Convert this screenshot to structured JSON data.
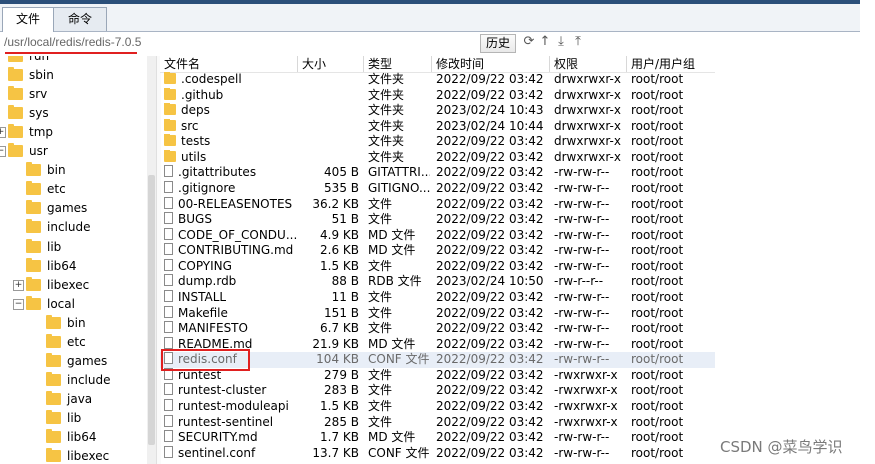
{
  "tabs": [
    {
      "label": "文件",
      "active": true
    },
    {
      "label": "命令",
      "active": false
    }
  ],
  "path": "/usr/local/redis/redis-7.0.5",
  "toolbar": {
    "history_label": "历史",
    "icons": [
      "refresh-icon",
      "up-directory-icon",
      "download-icon",
      "upload-icon"
    ]
  },
  "tree": [
    {
      "label": "run",
      "depth": 0
    },
    {
      "label": "sbin",
      "depth": 0
    },
    {
      "label": "srv",
      "depth": 0
    },
    {
      "label": "sys",
      "depth": 0
    },
    {
      "label": "tmp",
      "depth": 0,
      "expandable": true
    },
    {
      "label": "usr",
      "depth": 0,
      "expanded": true
    },
    {
      "label": "bin",
      "depth": 1
    },
    {
      "label": "etc",
      "depth": 1
    },
    {
      "label": "games",
      "depth": 1
    },
    {
      "label": "include",
      "depth": 1
    },
    {
      "label": "lib",
      "depth": 1
    },
    {
      "label": "lib64",
      "depth": 1
    },
    {
      "label": "libexec",
      "depth": 1,
      "expandable": true
    },
    {
      "label": "local",
      "depth": 1,
      "expanded": true
    },
    {
      "label": "bin",
      "depth": 2
    },
    {
      "label": "etc",
      "depth": 2
    },
    {
      "label": "games",
      "depth": 2
    },
    {
      "label": "include",
      "depth": 2
    },
    {
      "label": "java",
      "depth": 2
    },
    {
      "label": "lib",
      "depth": 2
    },
    {
      "label": "lib64",
      "depth": 2
    },
    {
      "label": "libexec",
      "depth": 2
    }
  ],
  "columns": [
    "文件名",
    "大小",
    "类型",
    "修改时间",
    "权限",
    "用户/用户组"
  ],
  "files": [
    {
      "name": ".codespell",
      "size": "",
      "type": "文件夹",
      "date": "2022/09/22 03:42",
      "perm": "drwxrwxr-x",
      "owner": "root/root",
      "folder": true
    },
    {
      "name": ".github",
      "size": "",
      "type": "文件夹",
      "date": "2022/09/22 03:42",
      "perm": "drwxrwxr-x",
      "owner": "root/root",
      "folder": true
    },
    {
      "name": "deps",
      "size": "",
      "type": "文件夹",
      "date": "2023/02/24 10:43",
      "perm": "drwxrwxr-x",
      "owner": "root/root",
      "folder": true
    },
    {
      "name": "src",
      "size": "",
      "type": "文件夹",
      "date": "2023/02/24 10:44",
      "perm": "drwxrwxr-x",
      "owner": "root/root",
      "folder": true
    },
    {
      "name": "tests",
      "size": "",
      "type": "文件夹",
      "date": "2022/09/22 03:42",
      "perm": "drwxrwxr-x",
      "owner": "root/root",
      "folder": true
    },
    {
      "name": "utils",
      "size": "",
      "type": "文件夹",
      "date": "2022/09/22 03:42",
      "perm": "drwxrwxr-x",
      "owner": "root/root",
      "folder": true
    },
    {
      "name": ".gitattributes",
      "size": "405 B",
      "type": "GITATTRI...",
      "date": "2022/09/22 03:42",
      "perm": "-rw-rw-r--",
      "owner": "root/root"
    },
    {
      "name": ".gitignore",
      "size": "535 B",
      "type": "GITIGNO...",
      "date": "2022/09/22 03:42",
      "perm": "-rw-rw-r--",
      "owner": "root/root"
    },
    {
      "name": "00-RELEASENOTES",
      "size": "36.2 KB",
      "type": "文件",
      "date": "2022/09/22 03:42",
      "perm": "-rw-rw-r--",
      "owner": "root/root"
    },
    {
      "name": "BUGS",
      "size": "51 B",
      "type": "文件",
      "date": "2022/09/22 03:42",
      "perm": "-rw-rw-r--",
      "owner": "root/root"
    },
    {
      "name": "CODE_OF_CONDU...",
      "size": "4.9 KB",
      "type": "MD 文件",
      "date": "2022/09/22 03:42",
      "perm": "-rw-rw-r--",
      "owner": "root/root"
    },
    {
      "name": "CONTRIBUTING.md",
      "size": "2.6 KB",
      "type": "MD 文件",
      "date": "2022/09/22 03:42",
      "perm": "-rw-rw-r--",
      "owner": "root/root"
    },
    {
      "name": "COPYING",
      "size": "1.5 KB",
      "type": "文件",
      "date": "2022/09/22 03:42",
      "perm": "-rw-rw-r--",
      "owner": "root/root"
    },
    {
      "name": "dump.rdb",
      "size": "88 B",
      "type": "RDB 文件",
      "date": "2023/02/24 10:50",
      "perm": "-rw-r--r--",
      "owner": "root/root"
    },
    {
      "name": "INSTALL",
      "size": "11 B",
      "type": "文件",
      "date": "2022/09/22 03:42",
      "perm": "-rw-rw-r--",
      "owner": "root/root"
    },
    {
      "name": "Makefile",
      "size": "151 B",
      "type": "文件",
      "date": "2022/09/22 03:42",
      "perm": "-rw-rw-r--",
      "owner": "root/root"
    },
    {
      "name": "MANIFESTO",
      "size": "6.7 KB",
      "type": "文件",
      "date": "2022/09/22 03:42",
      "perm": "-rw-rw-r--",
      "owner": "root/root"
    },
    {
      "name": "README.md",
      "size": "21.9 KB",
      "type": "MD 文件",
      "date": "2022/09/22 03:42",
      "perm": "-rw-rw-r--",
      "owner": "root/root"
    },
    {
      "name": "redis.conf",
      "size": "104 KB",
      "type": "CONF 文件",
      "date": "2022/09/22 03:42",
      "perm": "-rw-rw-r--",
      "owner": "root/root",
      "selected": true
    },
    {
      "name": "runtest",
      "size": "279 B",
      "type": "文件",
      "date": "2022/09/22 03:42",
      "perm": "-rwxrwxr-x",
      "owner": "root/root"
    },
    {
      "name": "runtest-cluster",
      "size": "283 B",
      "type": "文件",
      "date": "2022/09/22 03:42",
      "perm": "-rwxrwxr-x",
      "owner": "root/root"
    },
    {
      "name": "runtest-moduleapi",
      "size": "1.5 KB",
      "type": "文件",
      "date": "2022/09/22 03:42",
      "perm": "-rwxrwxr-x",
      "owner": "root/root"
    },
    {
      "name": "runtest-sentinel",
      "size": "285 B",
      "type": "文件",
      "date": "2022/09/22 03:42",
      "perm": "-rwxrwxr-x",
      "owner": "root/root"
    },
    {
      "name": "SECURITY.md",
      "size": "1.7 KB",
      "type": "MD 文件",
      "date": "2022/09/22 03:42",
      "perm": "-rw-rw-r--",
      "owner": "root/root"
    },
    {
      "name": "sentinel.conf",
      "size": "13.7 KB",
      "type": "CONF 文件",
      "date": "2022/09/22 03:42",
      "perm": "-rw-rw-r--",
      "owner": "root/root"
    }
  ],
  "watermark": "CSDN @菜鸟学识",
  "colors": {
    "highlight": "#e02020",
    "folder": "#f6c444",
    "selected_row": "#e8eef7"
  }
}
